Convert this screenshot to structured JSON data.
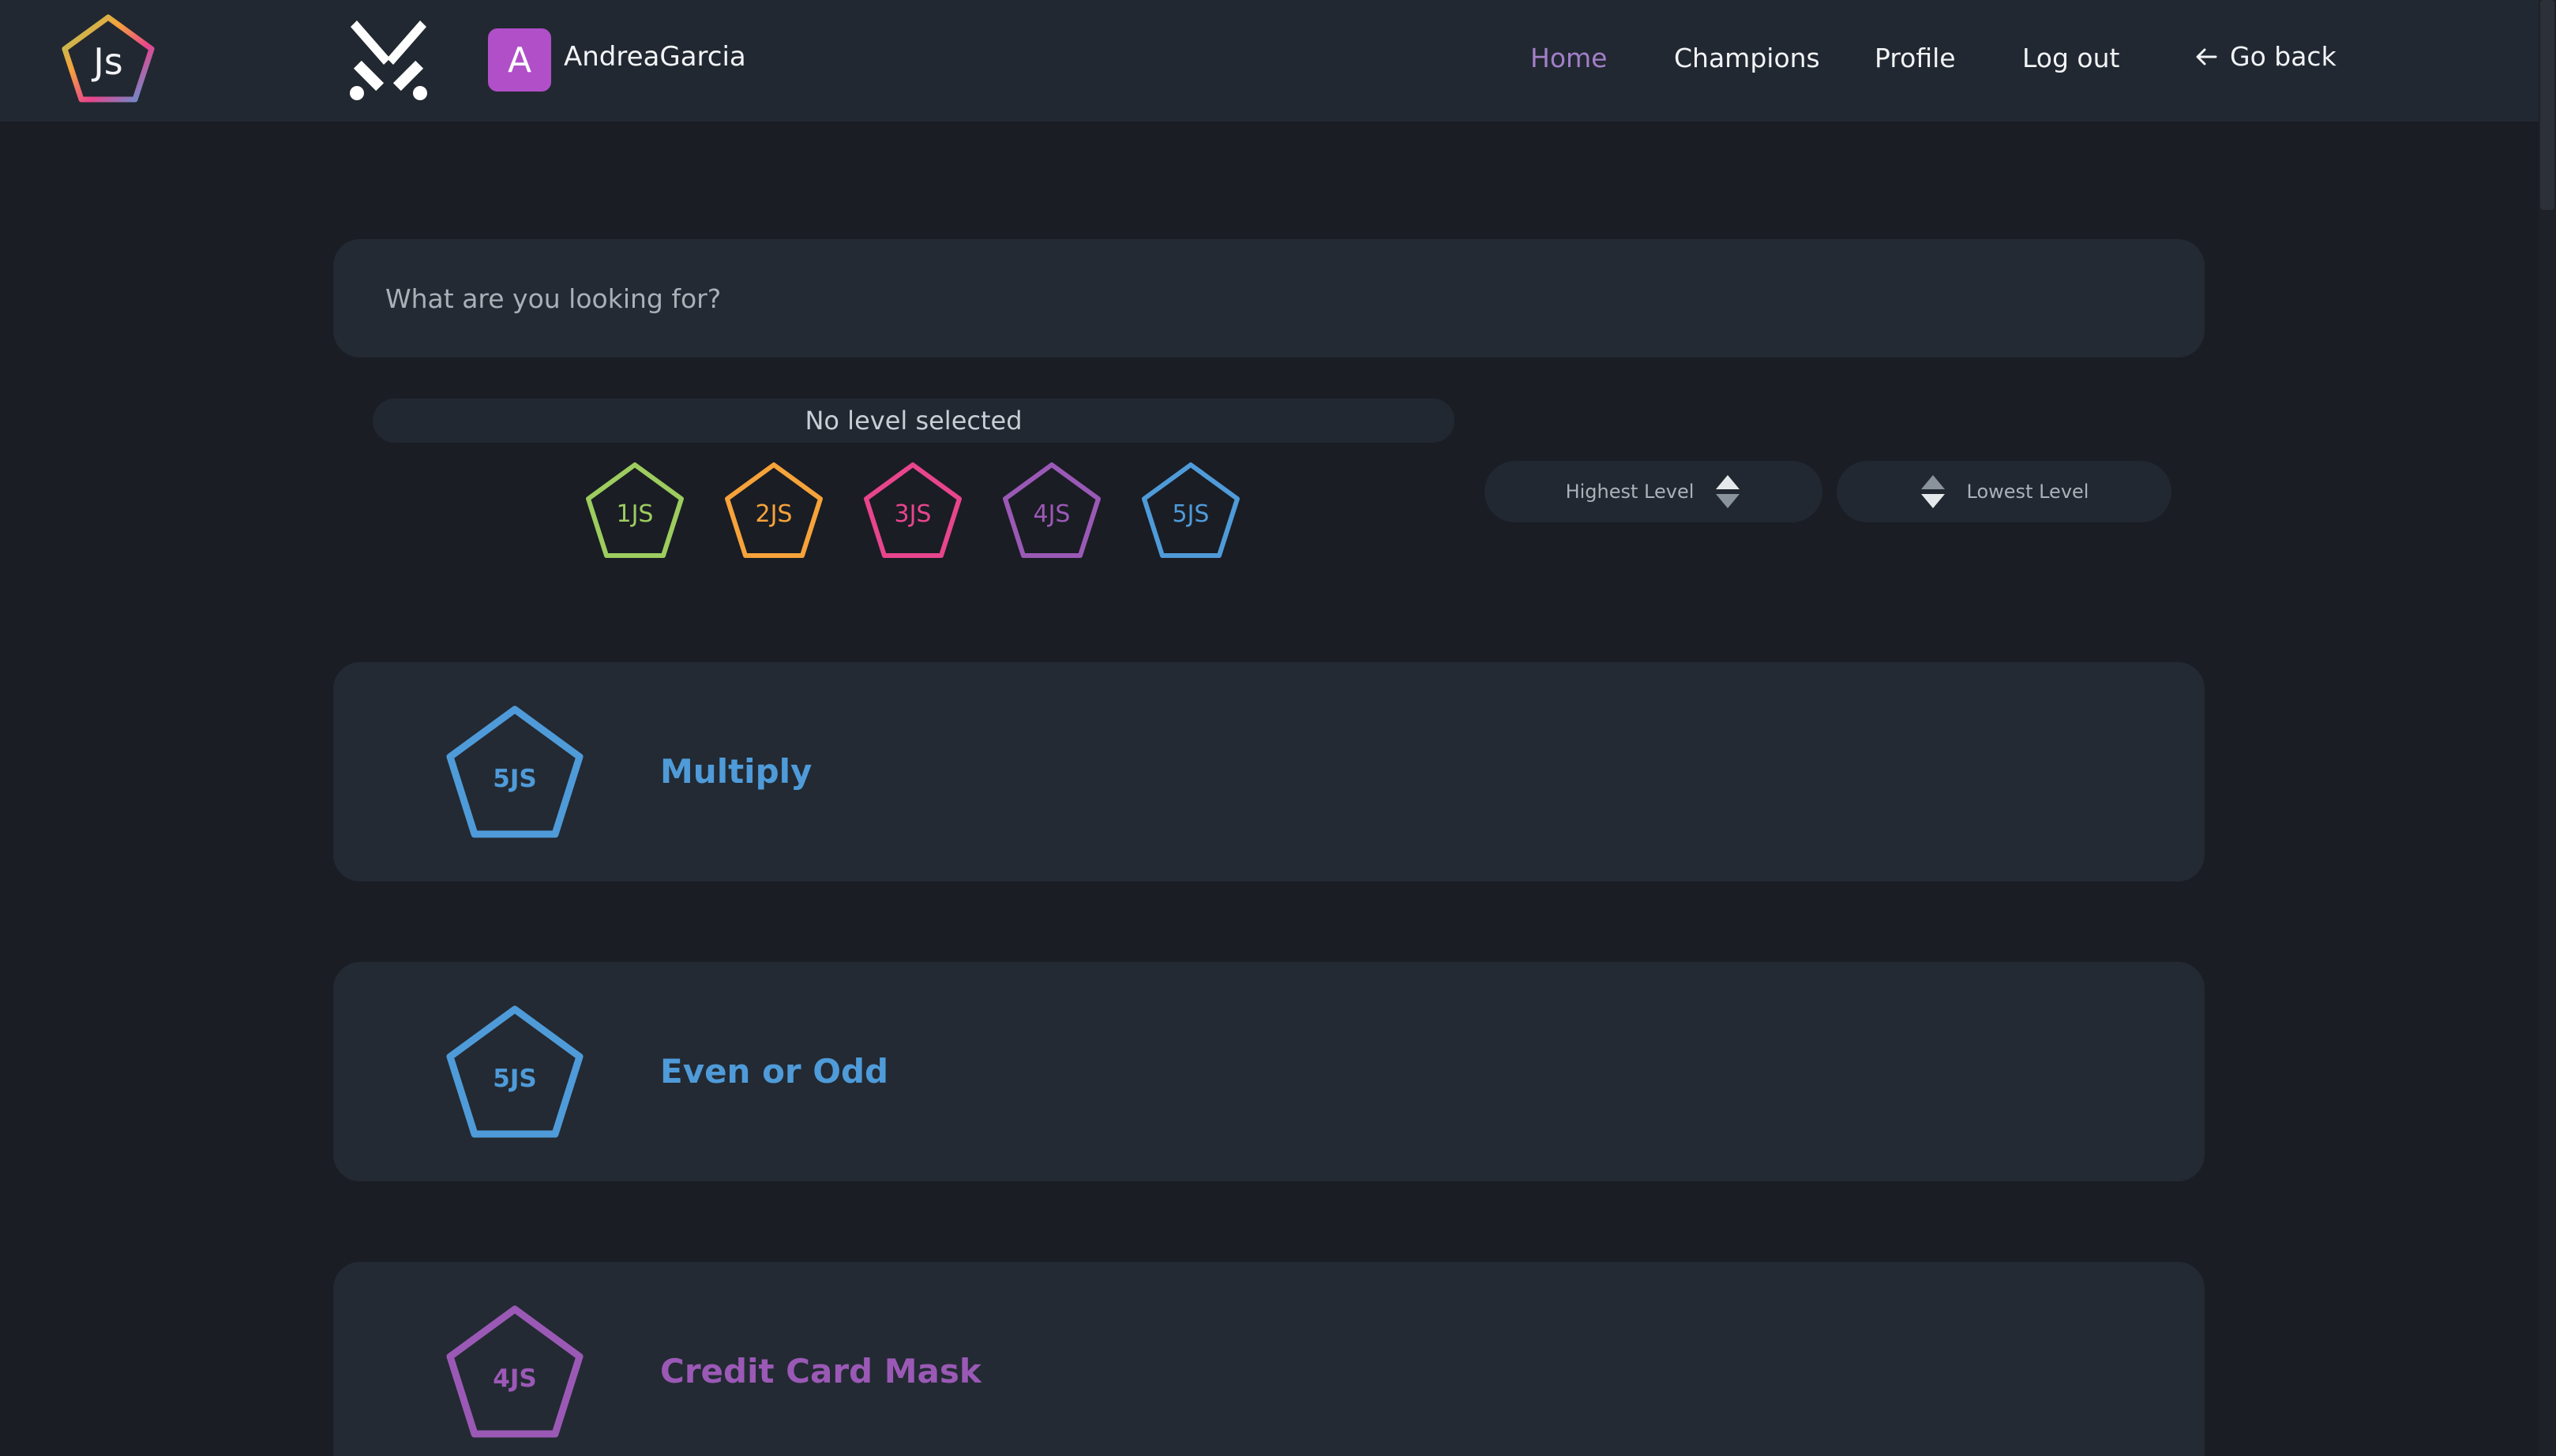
{
  "header": {
    "logo_text": "Js",
    "user": {
      "avatar_letter": "A",
      "name": "AndreaGarcia"
    },
    "nav": [
      {
        "label": "Home",
        "active": true
      },
      {
        "label": "Champions",
        "active": false
      },
      {
        "label": "Profile",
        "active": false
      },
      {
        "label": "Log out",
        "active": false
      }
    ],
    "go_back_label": "Go back"
  },
  "search": {
    "placeholder": "What are you looking for?",
    "value": ""
  },
  "level_filter": {
    "status_label": "No level selected",
    "levels": [
      {
        "label": "1JS",
        "color": "#9dcc5f"
      },
      {
        "label": "2JS",
        "color": "#f6a33a"
      },
      {
        "label": "3JS",
        "color": "#e8458d"
      },
      {
        "label": "4JS",
        "color": "#9b59b6"
      },
      {
        "label": "5JS",
        "color": "#4f9bd9"
      }
    ]
  },
  "sort": {
    "highest_label": "Highest Level",
    "lowest_label": "Lowest Level"
  },
  "challenges": [
    {
      "level": "5JS",
      "title": "Multiply",
      "color": "#4f9bd9"
    },
    {
      "level": "5JS",
      "title": "Even or Odd",
      "color": "#4f9bd9"
    },
    {
      "level": "4JS",
      "title": "Credit Card Mask",
      "color": "#9b59b6"
    }
  ]
}
